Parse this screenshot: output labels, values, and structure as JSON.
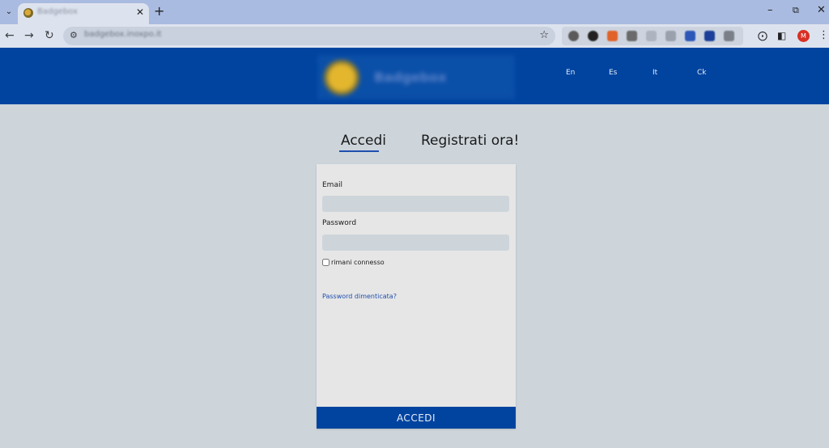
{
  "browser": {
    "tab_title": "Badgebox",
    "url": "badgebox.inoxpo.it",
    "profile_initial": "M",
    "icons": {
      "tab_search": "chevron-down-icon",
      "tab_close": "close-icon",
      "new_tab": "plus-icon",
      "back": "arrow-left-icon",
      "forward": "arrow-right-icon",
      "reload": "reload-icon",
      "site_info": "tune-icon",
      "bookmark": "star-icon",
      "extensions": "puzzle-icon",
      "side_panel": "side-panel-icon",
      "menu": "kebab-icon",
      "minimize": "minimize-icon",
      "restore": "restore-icon",
      "close_window": "close-icon"
    }
  },
  "header": {
    "logo_text": "Badgebox",
    "languages": [
      "En",
      "Es",
      "It",
      "Ck"
    ],
    "colors": {
      "brand_blue": "#0044a0"
    }
  },
  "auth": {
    "tabs": [
      "Accedi",
      "Registrati ora!"
    ],
    "active_tab": "Accedi"
  },
  "login": {
    "email_label": "Email",
    "email_value": "",
    "password_label": "Password",
    "password_value": "",
    "remember_label": "rimani connesso",
    "remember_checked": false,
    "forgot_link": "Password dimenticata?",
    "submit_label": "ACCEDI"
  }
}
